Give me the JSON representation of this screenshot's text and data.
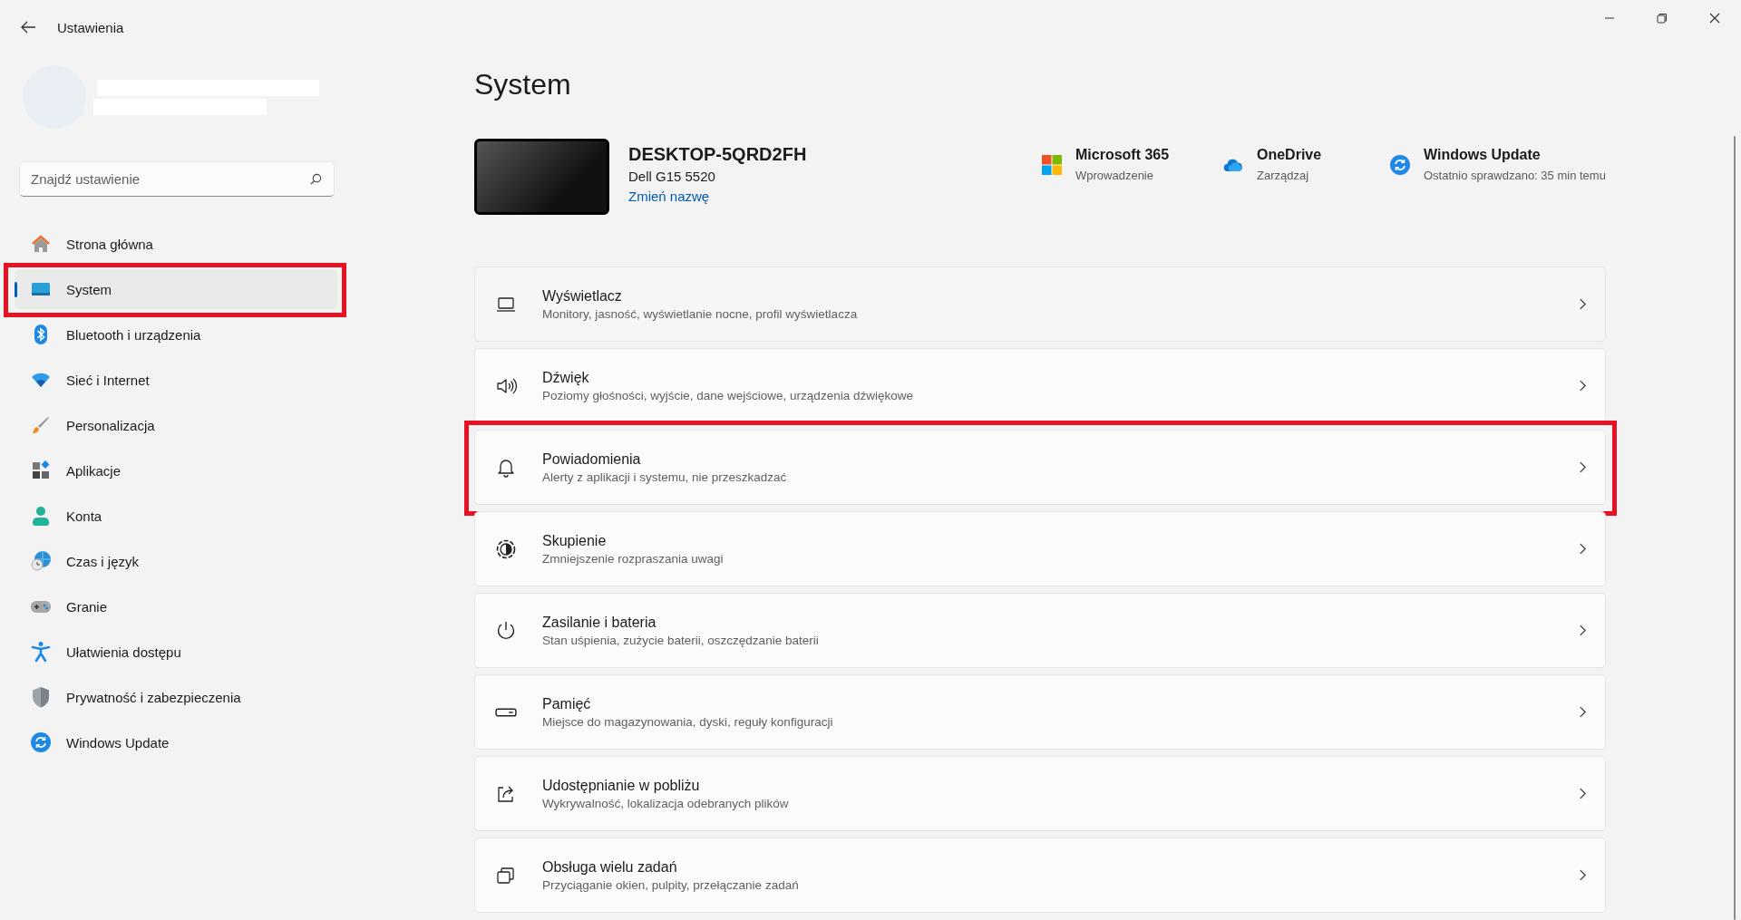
{
  "window": {
    "title": "Ustawienia"
  },
  "search": {
    "placeholder": "Znajdź ustawienie"
  },
  "sidebar": {
    "items": [
      {
        "label": "Strona główna",
        "selected": false,
        "highlighted": false
      },
      {
        "label": "System",
        "selected": true,
        "highlighted": true
      },
      {
        "label": "Bluetooth i urządzenia",
        "selected": false,
        "highlighted": false
      },
      {
        "label": "Sieć i Internet",
        "selected": false,
        "highlighted": false
      },
      {
        "label": "Personalizacja",
        "selected": false,
        "highlighted": false
      },
      {
        "label": "Aplikacje",
        "selected": false,
        "highlighted": false
      },
      {
        "label": "Konta",
        "selected": false,
        "highlighted": false
      },
      {
        "label": "Czas i język",
        "selected": false,
        "highlighted": false
      },
      {
        "label": "Granie",
        "selected": false,
        "highlighted": false
      },
      {
        "label": "Ułatwienia dostępu",
        "selected": false,
        "highlighted": false
      },
      {
        "label": "Prywatność i zabezpieczenia",
        "selected": false,
        "highlighted": false
      },
      {
        "label": "Windows Update",
        "selected": false,
        "highlighted": false
      }
    ]
  },
  "page_title": "System",
  "device": {
    "name": "DESKTOP-5QRD2FH",
    "model": "Dell G15 5520",
    "rename_link": "Zmień nazwę"
  },
  "quick_links": [
    {
      "title": "Microsoft 365",
      "subtitle": "Wprowadzenie"
    },
    {
      "title": "OneDrive",
      "subtitle": "Zarządzaj"
    },
    {
      "title": "Windows Update",
      "subtitle": "Ostatnio sprawdzano: 35 min temu"
    }
  ],
  "settings": [
    {
      "title": "Wyświetlacz",
      "subtitle": "Monitory, jasność, wyświetlanie nocne, profil wyświetlacza",
      "highlighted": false,
      "hovered": true
    },
    {
      "title": "Dźwięk",
      "subtitle": "Poziomy głośności, wyjście, dane wejściowe, urządzenia dźwiękowe",
      "highlighted": false,
      "hovered": false
    },
    {
      "title": "Powiadomienia",
      "subtitle": "Alerty z aplikacji i systemu, nie przeszkadzać",
      "highlighted": true,
      "hovered": false
    },
    {
      "title": "Skupienie",
      "subtitle": "Zmniejszenie rozpraszania uwagi",
      "highlighted": false,
      "hovered": false
    },
    {
      "title": "Zasilanie i bateria",
      "subtitle": "Stan uśpienia, zużycie baterii, oszczędzanie baterii",
      "highlighted": false,
      "hovered": false
    },
    {
      "title": "Pamięć",
      "subtitle": "Miejsce do magazynowania, dyski, reguły konfiguracji",
      "highlighted": false,
      "hovered": false
    },
    {
      "title": "Udostępnianie w pobliżu",
      "subtitle": "Wykrywalność, lokalizacja odebranych plików",
      "highlighted": false,
      "hovered": false
    },
    {
      "title": "Obsługa wielu zadań",
      "subtitle": "Przyciąganie okien, pulpity, przełączanie zadań",
      "highlighted": false,
      "hovered": false
    }
  ]
}
